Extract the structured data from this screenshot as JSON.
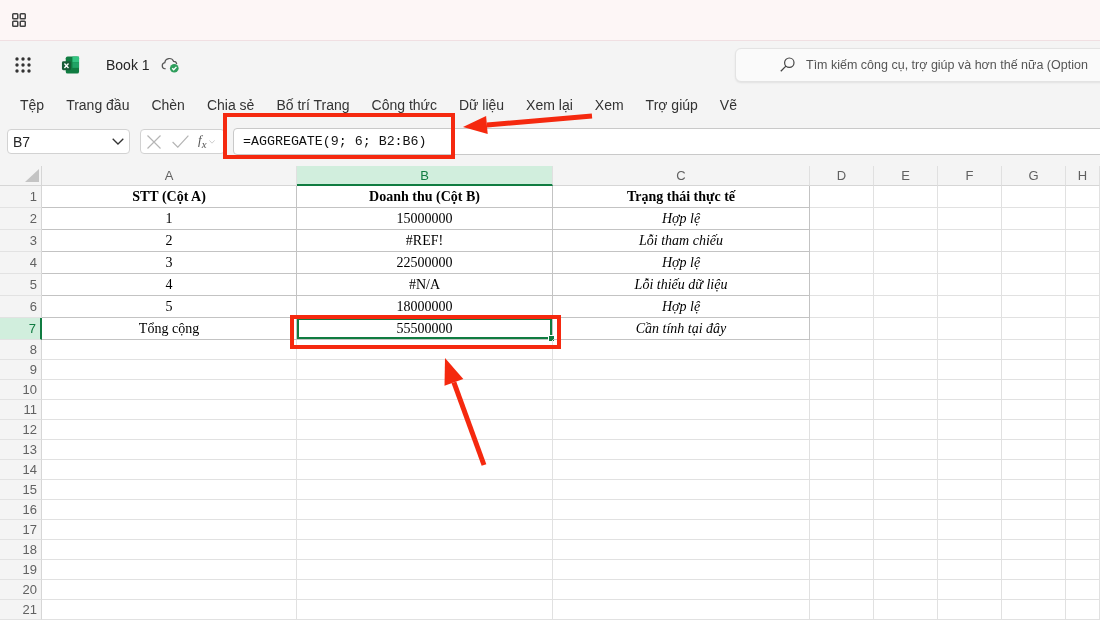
{
  "app_header": {
    "file_name": "Book 1",
    "search": {
      "placeholder": "Tìm kiếm công cụ, trợ giúp và hơn thế nữa (Option"
    }
  },
  "menu_tabs": [
    "Tệp",
    "Trang đầu",
    "Chèn",
    "Chia sẻ",
    "Bố trí Trang",
    "Công thức",
    "Dữ liệu",
    "Xem lại",
    "Xem",
    "Trợ giúp",
    "Vẽ"
  ],
  "formula_bar": {
    "name_box": "B7",
    "function_button": "*f*$_{x}$",
    "formula": "=AGGREGATE(9; 6; B2:B6)"
  },
  "sheet": {
    "columns": [
      {
        "label": "A",
        "selected": false
      },
      {
        "label": "B",
        "selected": true
      },
      {
        "label": "C",
        "selected": false
      },
      {
        "label": "D",
        "selected": false
      },
      {
        "label": "E",
        "selected": false
      },
      {
        "label": "F",
        "selected": false
      },
      {
        "label": "G",
        "selected": false
      },
      {
        "label": "H",
        "selected": false
      }
    ],
    "rows": [
      {
        "number": "1",
        "selected": false,
        "cells": [
          {
            "text": "STT (Cột A)",
            "kind": "heading",
            "selected": false
          },
          {
            "text": "Doanh thu (Cột B)",
            "kind": "heading",
            "selected": false
          },
          {
            "text": "Trạng thái thực tế",
            "kind": "heading",
            "selected": false
          }
        ]
      },
      {
        "number": "2",
        "selected": false,
        "cells": [
          {
            "text": "1",
            "kind": "value",
            "selected": false
          },
          {
            "text": "15000000",
            "kind": "value",
            "selected": false
          },
          {
            "text": "Hợp lệ",
            "kind": "status",
            "selected": false
          }
        ]
      },
      {
        "number": "3",
        "selected": false,
        "cells": [
          {
            "text": "2",
            "kind": "value",
            "selected": false
          },
          {
            "text": "#REF!",
            "kind": "value",
            "selected": false
          },
          {
            "text": "Lỗi tham chiếu",
            "kind": "status",
            "selected": false
          }
        ]
      },
      {
        "number": "4",
        "selected": false,
        "cells": [
          {
            "text": "3",
            "kind": "value",
            "selected": false
          },
          {
            "text": "22500000",
            "kind": "value",
            "selected": false
          },
          {
            "text": "Hợp lệ",
            "kind": "status",
            "selected": false
          }
        ]
      },
      {
        "number": "5",
        "selected": false,
        "cells": [
          {
            "text": "4",
            "kind": "value",
            "selected": false
          },
          {
            "text": "#N/A",
            "kind": "value",
            "selected": false
          },
          {
            "text": "Lỗi thiếu dữ liệu",
            "kind": "status",
            "selected": false
          }
        ]
      },
      {
        "number": "6",
        "selected": false,
        "cells": [
          {
            "text": "5",
            "kind": "value",
            "selected": false
          },
          {
            "text": "18000000",
            "kind": "value",
            "selected": false
          },
          {
            "text": "Hợp lệ",
            "kind": "status",
            "selected": false
          }
        ]
      },
      {
        "number": "7",
        "selected": true,
        "cells": [
          {
            "text": "Tổng cộng",
            "kind": "value",
            "selected": false
          },
          {
            "text": "55500000",
            "kind": "value",
            "selected": true
          },
          {
            "text": "Cần tính tại đây",
            "kind": "status",
            "selected": false
          }
        ]
      },
      {
        "number": "8",
        "selected": false
      },
      {
        "number": "9",
        "selected": false
      },
      {
        "number": "10",
        "selected": false
      },
      {
        "number": "11",
        "selected": false
      },
      {
        "number": "12",
        "selected": false
      },
      {
        "number": "13",
        "selected": false
      },
      {
        "number": "14",
        "selected": false
      },
      {
        "number": "15",
        "selected": false
      },
      {
        "number": "16",
        "selected": false
      },
      {
        "number": "17",
        "selected": false
      },
      {
        "number": "18",
        "selected": false
      },
      {
        "number": "19",
        "selected": false
      },
      {
        "number": "20",
        "selected": false
      },
      {
        "number": "21",
        "selected": false
      }
    ]
  },
  "annotations": [
    {
      "kind": "frame"
    },
    {
      "kind": "arrow"
    },
    {
      "kind": "frame"
    },
    {
      "kind": "arrow"
    }
  ]
}
